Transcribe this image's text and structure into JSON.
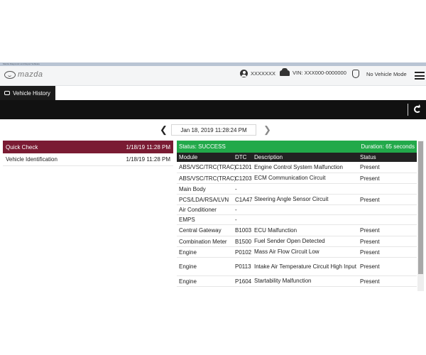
{
  "window": {
    "title": "Mazda Diagnostic and Repair Software"
  },
  "header": {
    "brand": "mazda",
    "user": "XXXXXXX",
    "vin": "VIN: XXX000-0000000",
    "mode": "No Vehicle Mode"
  },
  "tab": {
    "label": "Vehicle History"
  },
  "nav": {
    "date": "Jan 18, 2019 11:28:24 PM"
  },
  "sessions": [
    {
      "name": "Quick Check",
      "time": "1/18/19 11:28 PM"
    },
    {
      "name": "Vehicle Identification",
      "time": "1/18/19 11:28 PM"
    }
  ],
  "result": {
    "status": "Status: SUCCESS",
    "duration": "Duration: 65 seconds",
    "columns": [
      "Module",
      "DTC",
      "Description",
      "Status"
    ],
    "rows": [
      {
        "module": "ABS/VSC/TRC(TRAC)",
        "dtc": "C1201",
        "desc": "Engine Control System Malfunction",
        "status": "Present"
      },
      {
        "module": "ABS/VSC/TRC(TRAC)",
        "dtc": "C1203",
        "desc": "ECM Communication Circuit",
        "status": "Present"
      },
      {
        "module": "Main Body",
        "dtc": "-",
        "desc": "",
        "status": ""
      },
      {
        "module": "PCS/LDA/RSA/LVN",
        "dtc": "C1A47",
        "desc": "Steering Angle Sensor Circuit",
        "status": "Present"
      },
      {
        "module": "Air Conditioner",
        "dtc": "-",
        "desc": "",
        "status": ""
      },
      {
        "module": "EMPS",
        "dtc": "-",
        "desc": "",
        "status": ""
      },
      {
        "module": "Central Gateway",
        "dtc": "B1003",
        "desc": "ECU Malfunction",
        "status": "Present"
      },
      {
        "module": "Combination Meter",
        "dtc": "B1500",
        "desc": "Fuel Sender Open Detected",
        "status": "Present"
      },
      {
        "module": "Engine",
        "dtc": "P0102",
        "desc": "Mass Air Flow Circuit Low",
        "status": "Present"
      },
      {
        "module": "Engine",
        "dtc": "P0113",
        "desc": "Intake Air Temperature Circuit High Input",
        "status": "Present"
      },
      {
        "module": "Engine",
        "dtc": "P1604",
        "desc": "Startability Malfunction",
        "status": "Present"
      }
    ]
  },
  "colors": {
    "active_row": "#7a1b33",
    "status_bar": "#22a94a",
    "header_dark": "#111111"
  }
}
